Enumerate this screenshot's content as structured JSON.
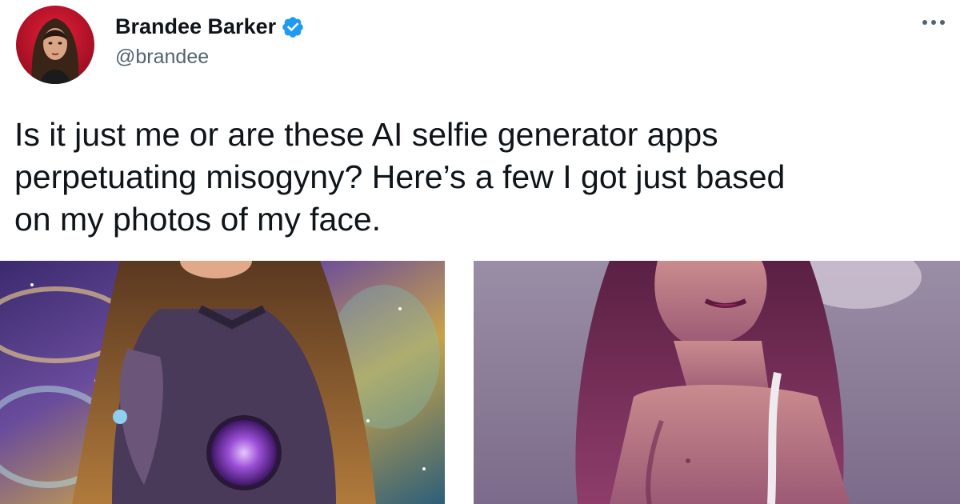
{
  "tweet": {
    "author": {
      "display_name": "Brandee Barker",
      "handle": "@brandee",
      "verified": true,
      "avatar_icon": "profile-photo"
    },
    "more_icon": "more-dots-icon",
    "text": "Is it just me or are these AI selfie generator apps\nperpetuating misogyny? Here’s a few I got just based\non my photos of my face.",
    "media": [
      {
        "kind": "ai-generated-portrait",
        "style": "cosmic purple"
      },
      {
        "kind": "ai-generated-portrait",
        "style": "violet illustration"
      }
    ]
  },
  "colors": {
    "verified_blue": "#1d9bf0",
    "handle_gray": "#536471",
    "text_dark": "#0f1419",
    "avatar_red": "#c8102e"
  }
}
